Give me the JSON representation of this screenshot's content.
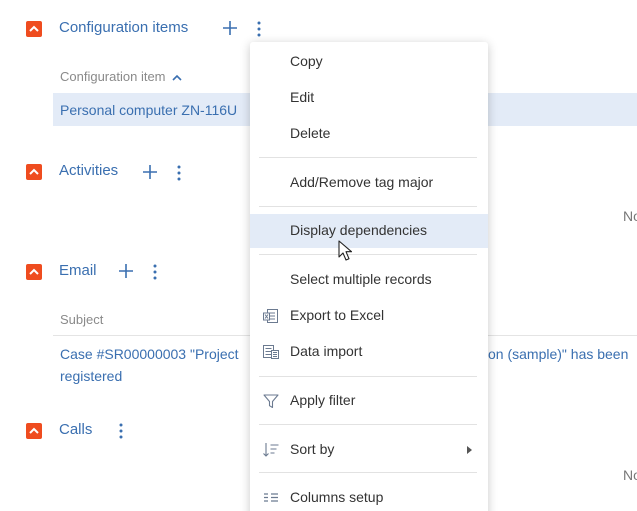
{
  "groups": {
    "configuration_items": {
      "title": "Configuration items",
      "column_header": "Configuration item",
      "row_value": "Personal computer ZN-116U"
    },
    "activities": {
      "title": "Activities",
      "truncated": "No"
    },
    "email": {
      "title": "Email",
      "column_header": "Subject",
      "row_line1_start": "Case #SR00000003 \"Project",
      "row_line1_end": "on (sample)\" has been",
      "row_line2": "registered"
    },
    "calls": {
      "title": "Calls",
      "truncated": "No"
    }
  },
  "context_menu": {
    "items": [
      {
        "label": "Copy"
      },
      {
        "label": "Edit"
      },
      {
        "label": "Delete"
      },
      {
        "label": "Add/Remove tag major"
      },
      {
        "label": "Display dependencies",
        "highlighted": true
      },
      {
        "label": "Select multiple records"
      },
      {
        "label": "Export to Excel",
        "icon": "excel-export-icon"
      },
      {
        "label": "Data import",
        "icon": "data-import-icon"
      },
      {
        "label": "Apply filter",
        "icon": "filter-icon"
      },
      {
        "label": "Sort by",
        "icon": "sort-icon",
        "has_submenu": true
      },
      {
        "label": "Columns setup",
        "icon": "columns-setup-icon"
      }
    ]
  },
  "colors": {
    "accent": "#3a6fb0",
    "collapse_button": "#ef4c1f",
    "selected_row": "#e3ebf7",
    "menu_hover": "#e3ebf7"
  }
}
